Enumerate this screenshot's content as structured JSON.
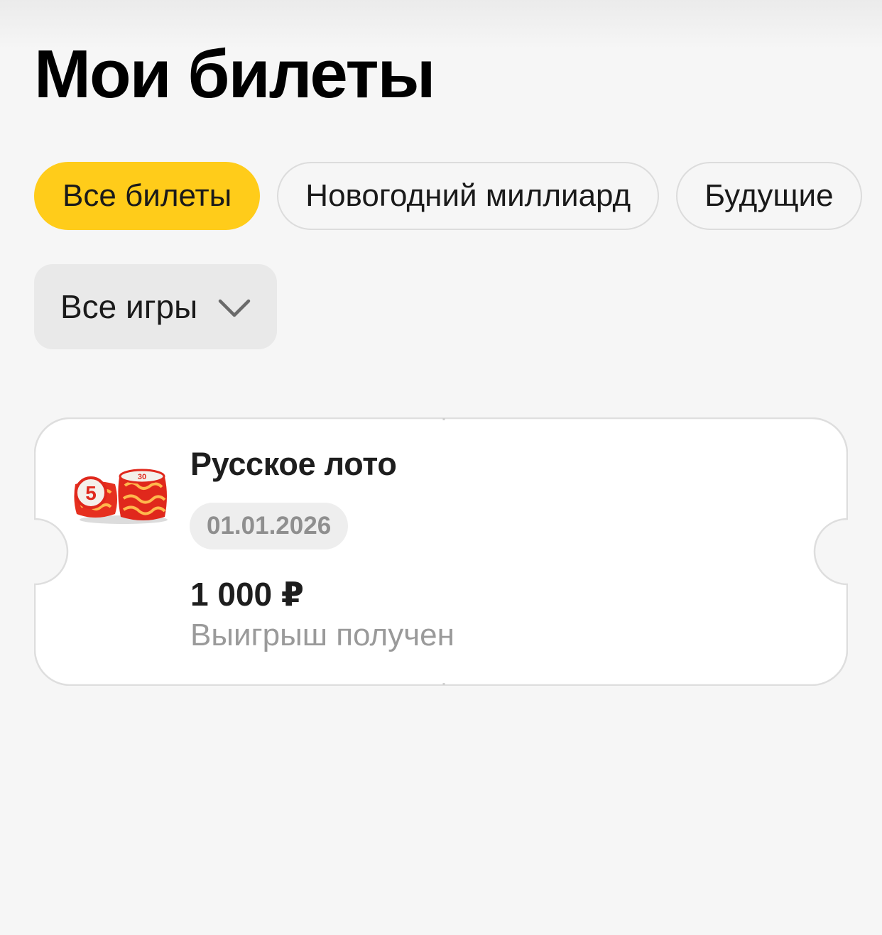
{
  "header": {
    "title": "Мои билеты"
  },
  "tabs": [
    {
      "label": "Все билеты",
      "active": true
    },
    {
      "label": "Новогодний миллиард",
      "active": false
    },
    {
      "label": "Будущие",
      "active": false
    }
  ],
  "filter": {
    "selected": "Все игры",
    "icon": "chevron-down-icon"
  },
  "tickets": [
    {
      "game": "Русское лото",
      "date": "01.01.2026",
      "amount": "1 000 ₽",
      "status": "Выигрыш получен",
      "logo_numbers": [
        "5",
        "30"
      ]
    }
  ],
  "colors": {
    "accent": "#ffcc1a",
    "background": "#f6f6f6",
    "logo_red": "#e0281c"
  }
}
